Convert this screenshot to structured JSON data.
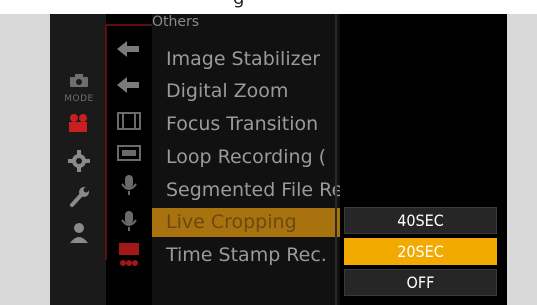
{
  "header": {
    "partial_title": "g"
  },
  "tabs": [
    {
      "name": "mode",
      "label": "MODE",
      "icon": "camera-icon"
    },
    {
      "name": "video",
      "icon": "video-camera-icon"
    },
    {
      "name": "custom",
      "icon": "gear-icon"
    },
    {
      "name": "setup",
      "icon": "wrench-icon"
    },
    {
      "name": "my-menu",
      "icon": "person-icon"
    }
  ],
  "menu": {
    "section_title": "Others",
    "items": [
      {
        "label": "Image Stabilizer"
      },
      {
        "label": "Digital Zoom"
      },
      {
        "label": "Focus Transition"
      },
      {
        "label": "Loop Recording ("
      },
      {
        "label": "Segmented File Re"
      },
      {
        "label": "Live Cropping",
        "selected": true
      },
      {
        "label": "Time Stamp Rec."
      }
    ]
  },
  "options": {
    "items": [
      {
        "label": "40SEC"
      },
      {
        "label": "20SEC",
        "selected": true
      },
      {
        "label": "OFF"
      }
    ]
  },
  "colors": {
    "highlight": "#f2a900",
    "selected_row": "#a8720f",
    "accent_red": "#c82020"
  }
}
